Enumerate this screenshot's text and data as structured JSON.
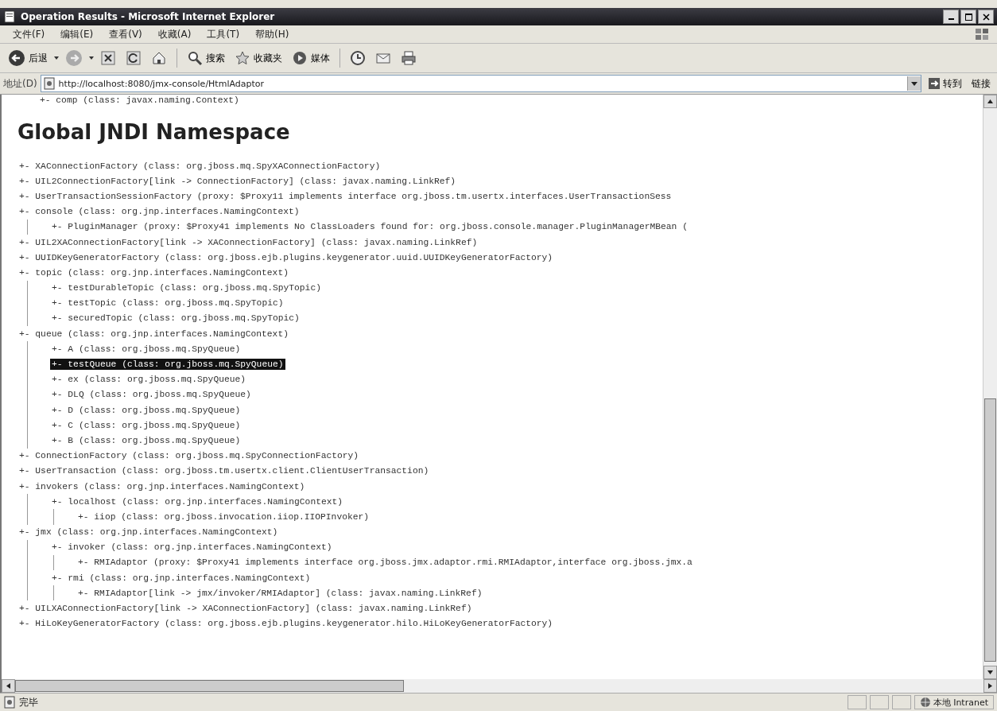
{
  "window": {
    "title": "Operation Results - Microsoft Internet Explorer"
  },
  "menu": [
    "文件(F)",
    "编辑(E)",
    "查看(V)",
    "收藏(A)",
    "工具(T)",
    "帮助(H)"
  ],
  "toolbar": [
    {
      "kind": "back",
      "label": "后退"
    },
    {
      "kind": "forward"
    },
    {
      "kind": "stop"
    },
    {
      "kind": "refresh"
    },
    {
      "kind": "home"
    },
    {
      "kind": "search",
      "label": "搜索"
    },
    {
      "kind": "favorites",
      "label": "收藏夹"
    },
    {
      "kind": "media",
      "label": "媒体"
    },
    {
      "kind": "history"
    },
    {
      "kind": "mail"
    },
    {
      "kind": "print"
    }
  ],
  "address": {
    "label": "地址(D)",
    "value": "http://localhost:8080/jmx-console/HtmlAdaptor",
    "go": "转到",
    "links": "链接"
  },
  "page": {
    "cut_line": "+- comp (class: javax.naming.Context)",
    "heading": "Global JNDI Namespace",
    "tree": [
      {
        "text": "+- XAConnectionFactory (class: org.jboss.mq.SpyXAConnectionFactory)",
        "selected": false
      },
      {
        "text": "+- UIL2ConnectionFactory[link -> ConnectionFactory] (class: javax.naming.LinkRef)",
        "selected": false
      },
      {
        "text": "+- UserTransactionSessionFactory (proxy: $Proxy11 implements interface org.jboss.tm.usertx.interfaces.UserTransactionSess",
        "selected": false
      },
      {
        "text": "+- console (class: org.jnp.interfaces.NamingContext)",
        "selected": false,
        "children": [
          {
            "text": "+- PluginManager (proxy: $Proxy41 implements No ClassLoaders found for: org.jboss.console.manager.PluginManagerMBean (",
            "selected": false
          }
        ]
      },
      {
        "text": "+- UIL2XAConnectionFactory[link -> XAConnectionFactory] (class: javax.naming.LinkRef)",
        "selected": false
      },
      {
        "text": "+- UUIDKeyGeneratorFactory (class: org.jboss.ejb.plugins.keygenerator.uuid.UUIDKeyGeneratorFactory)",
        "selected": false
      },
      {
        "text": "+- topic (class: org.jnp.interfaces.NamingContext)",
        "selected": false,
        "children": [
          {
            "text": "+- testDurableTopic (class: org.jboss.mq.SpyTopic)",
            "selected": false
          },
          {
            "text": "+- testTopic (class: org.jboss.mq.SpyTopic)",
            "selected": false
          },
          {
            "text": "+- securedTopic (class: org.jboss.mq.SpyTopic)",
            "selected": false
          }
        ]
      },
      {
        "text": "+- queue (class: org.jnp.interfaces.NamingContext)",
        "selected": false,
        "children": [
          {
            "text": "+- A (class: org.jboss.mq.SpyQueue)",
            "selected": false
          },
          {
            "text": "+- testQueue (class: org.jboss.mq.SpyQueue)",
            "selected": true
          },
          {
            "text": "+- ex (class: org.jboss.mq.SpyQueue)",
            "selected": false
          },
          {
            "text": "+- DLQ (class: org.jboss.mq.SpyQueue)",
            "selected": false
          },
          {
            "text": "+- D (class: org.jboss.mq.SpyQueue)",
            "selected": false
          },
          {
            "text": "+- C (class: org.jboss.mq.SpyQueue)",
            "selected": false
          },
          {
            "text": "+- B (class: org.jboss.mq.SpyQueue)",
            "selected": false
          }
        ]
      },
      {
        "text": "+- ConnectionFactory (class: org.jboss.mq.SpyConnectionFactory)",
        "selected": false
      },
      {
        "text": "+- UserTransaction (class: org.jboss.tm.usertx.client.ClientUserTransaction)",
        "selected": false
      },
      {
        "text": "+- invokers (class: org.jnp.interfaces.NamingContext)",
        "selected": false,
        "children": [
          {
            "text": "+- localhost (class: org.jnp.interfaces.NamingContext)",
            "selected": false,
            "children": [
              {
                "text": "+- iiop (class: org.jboss.invocation.iiop.IIOPInvoker)",
                "selected": false
              }
            ]
          }
        ]
      },
      {
        "text": "+- jmx (class: org.jnp.interfaces.NamingContext)",
        "selected": false,
        "children": [
          {
            "text": "+- invoker (class: org.jnp.interfaces.NamingContext)",
            "selected": false,
            "children": [
              {
                "text": "+- RMIAdaptor (proxy: $Proxy41 implements interface org.jboss.jmx.adaptor.rmi.RMIAdaptor,interface org.jboss.jmx.a",
                "selected": false
              }
            ]
          },
          {
            "text": "+- rmi (class: org.jnp.interfaces.NamingContext)",
            "selected": false,
            "children": [
              {
                "text": "+- RMIAdaptor[link -> jmx/invoker/RMIAdaptor] (class: javax.naming.LinkRef)",
                "selected": false
              }
            ]
          }
        ]
      },
      {
        "text": "+- UILXAConnectionFactory[link -> XAConnectionFactory] (class: javax.naming.LinkRef)",
        "selected": false
      },
      {
        "text": "+- HiLoKeyGeneratorFactory (class: org.jboss.ejb.plugins.keygenerator.hilo.HiLoKeyGeneratorFactory)",
        "selected": false
      }
    ]
  },
  "status_bar": {
    "text": "完毕",
    "zone": "本地 Intranet"
  }
}
